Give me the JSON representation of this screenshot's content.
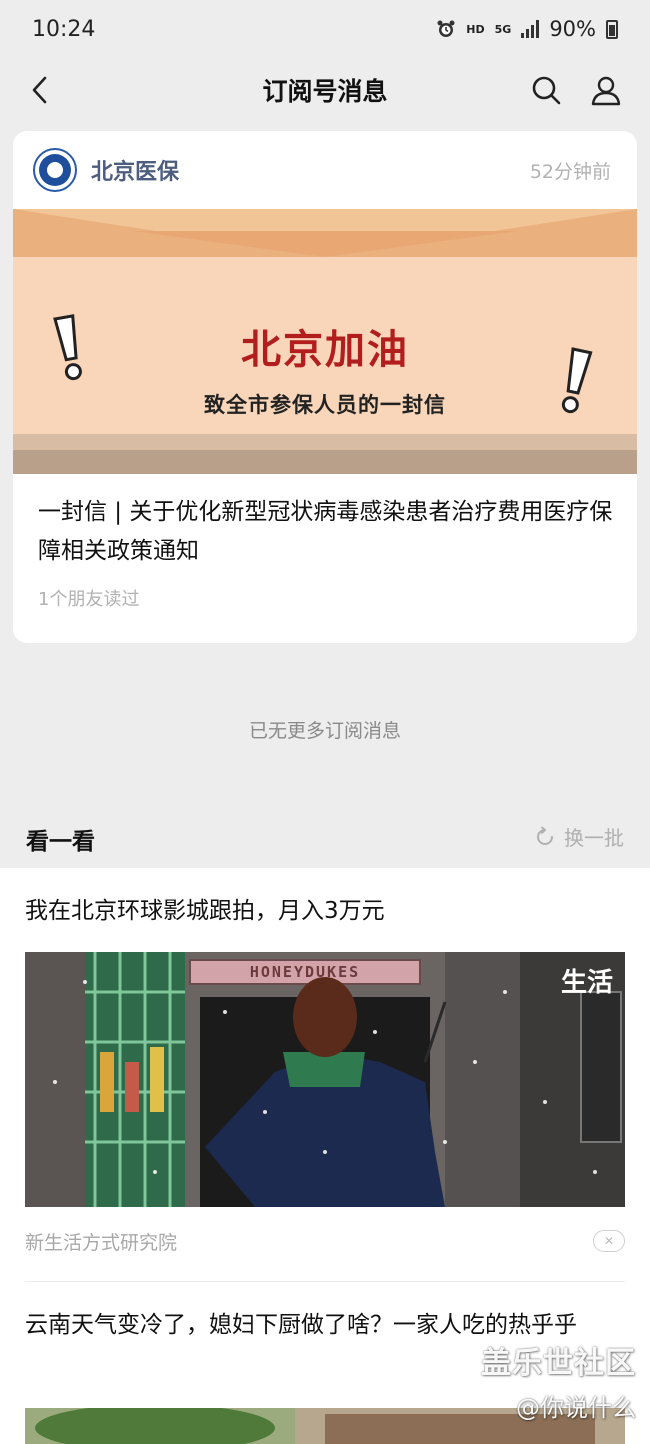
{
  "status_bar": {
    "time": "10:24",
    "hd": "HD",
    "network": "5G",
    "battery": "90%"
  },
  "nav": {
    "title": "订阅号消息"
  },
  "card": {
    "account_name": "北京医保",
    "time": "52分钟前",
    "banner": {
      "title": "北京加油",
      "subtitle": "致全市参保人员的一封信"
    },
    "article_title": "一封信 | 关于优化新型冠状病毒感染患者治疗费用医疗保障相关政策通知",
    "read_info": "1个朋友读过"
  },
  "no_more": "已无更多订阅消息",
  "section": {
    "title": "看一看",
    "refresh_label": "换一批"
  },
  "feed": [
    {
      "title": "我在北京环球影城跟拍，月入3万元",
      "sign_text": "HONEYDUKES",
      "overlay_tag": "生活",
      "source": "新生活方式研究院"
    },
    {
      "title": "云南天气变冷了，媳妇下厨做了啥？一家人吃的热乎乎"
    }
  ],
  "watermark": {
    "line1": "盖乐世社区",
    "line2": "@你说什么"
  },
  "colors": {
    "background": "#ededed",
    "card": "#ffffff",
    "account": "#4c5d7e",
    "muted": "#b2b2b2",
    "banner_red": "#b21d1d",
    "banner_bg": "#f9d6b9"
  }
}
